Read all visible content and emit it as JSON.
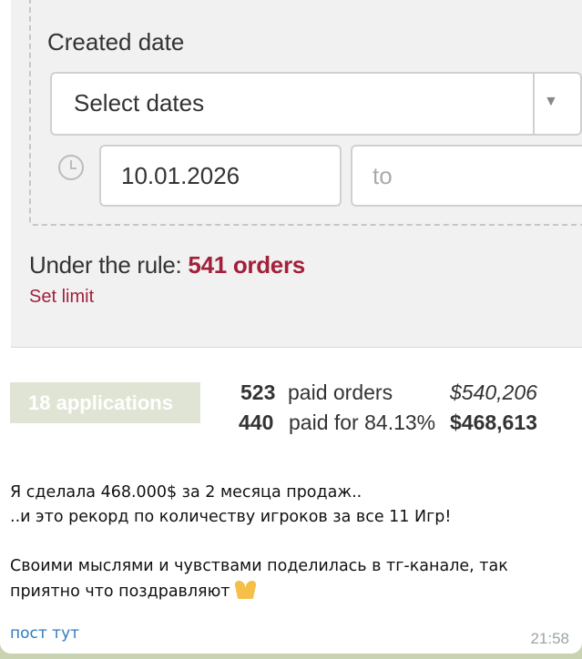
{
  "filter": {
    "title": "Created date",
    "select_placeholder": "Select dates",
    "date_from": "10.01.2026",
    "date_to_placeholder": "to",
    "rule_prefix": "Under the rule:",
    "rule_count": "541 orders",
    "set_limit": "Set limit"
  },
  "stats": {
    "applications": "18 applications",
    "paid_orders_count": "523",
    "paid_orders_label": "paid orders",
    "paid_orders_amount": "$540,206",
    "paid_for_count": "440",
    "paid_for_label": "paid for 84.13%",
    "paid_for_amount": "$468,613"
  },
  "message": {
    "line1": "Я сделала 468.000$ за 2 месяца продаж..",
    "line2": "..и это рекорд по количеству игроков за все 11 Игр!",
    "line3": "Своими мыслями и чувствами поделилась в тг-канале, так",
    "line4": "приятно что поздравляют",
    "link": "пост тут",
    "time": "21:58"
  },
  "icons": {
    "select_caret": "▼",
    "pray": "folded-hands-icon",
    "clock": "clock-icon"
  },
  "colors": {
    "accent": "#a3203b",
    "link": "#2f7ac0",
    "chat_background": "#c9d3b2"
  }
}
